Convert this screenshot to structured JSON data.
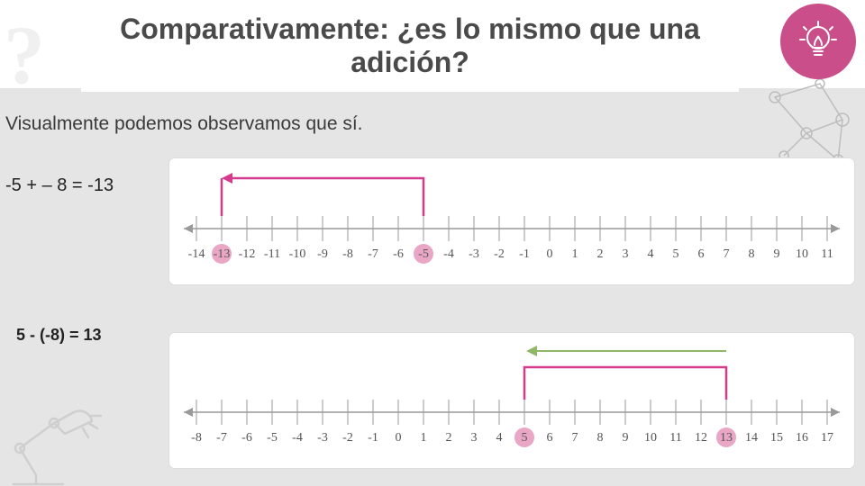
{
  "title": "Comparativamente: ¿es lo mismo que una adición?",
  "subtitle": "Visualmente podemos  observamos que sí.",
  "equation1": "-5  + – 8  = -13",
  "equation2": "5 - (-8) = 13",
  "chart_data": [
    {
      "type": "number-line",
      "range": [
        -14,
        11
      ],
      "tick_labels": [
        "-14",
        "-13",
        "-12",
        "-11",
        "-10",
        "-9",
        "-8",
        "-7",
        "-6",
        "-5",
        "-4",
        "-3",
        "-2",
        "-1",
        "0",
        "1",
        "2",
        "3",
        "4",
        "5",
        "6",
        "7",
        "8",
        "9",
        "10",
        "11"
      ],
      "highlights": [
        -13,
        -5
      ],
      "arrows": [
        {
          "from": -5,
          "to": -13,
          "color": "#d63a8f",
          "style": "bracket"
        }
      ],
      "note": "Start at -5, move left 8 units to -13"
    },
    {
      "type": "number-line",
      "range": [
        -8,
        17
      ],
      "tick_labels": [
        "-8",
        "-7",
        "-6",
        "-5",
        "-4",
        "-3",
        "-2",
        "-1",
        "0",
        "1",
        "2",
        "3",
        "4",
        "5",
        "6",
        "7",
        "8",
        "9",
        "10",
        "11",
        "12",
        "13",
        "14",
        "15",
        "16",
        "17"
      ],
      "highlights": [
        5,
        13
      ],
      "arrows": [
        {
          "from": 5,
          "to": 13,
          "color": "#d63a8f",
          "style": "bracket-pink"
        },
        {
          "from": 13,
          "to": 5,
          "color": "#8fb765",
          "style": "arrow-green"
        }
      ],
      "note": "5 subtract (-8) lands on 13; a green arrow at top points left from 13 toward 5"
    }
  ],
  "icons": {
    "bulb": "lightbulb-icon",
    "network": "network-deco",
    "lamp": "desk-lamp-deco"
  }
}
